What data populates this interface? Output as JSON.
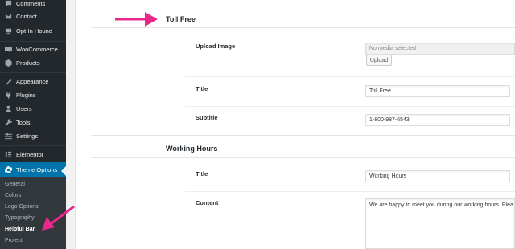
{
  "sidebar": {
    "items": [
      {
        "label": "Comments",
        "icon": "comments-icon"
      },
      {
        "label": "Contact",
        "icon": "mail-icon"
      },
      {
        "label": "Opt-In Hound",
        "icon": "optin-icon"
      },
      {
        "label": "WooCommerce",
        "icon": "woocommerce-icon"
      },
      {
        "label": "Products",
        "icon": "products-icon"
      },
      {
        "label": "Appearance",
        "icon": "appearance-icon"
      },
      {
        "label": "Plugins",
        "icon": "plugins-icon"
      },
      {
        "label": "Users",
        "icon": "users-icon"
      },
      {
        "label": "Tools",
        "icon": "tools-icon"
      },
      {
        "label": "Settings",
        "icon": "settings-icon"
      },
      {
        "label": "Elementor",
        "icon": "elementor-icon"
      },
      {
        "label": "Theme Options",
        "icon": "gear-icon"
      }
    ],
    "submenu": [
      "General",
      "Colors",
      "Logo Options",
      "Typography",
      "Helpful Bar",
      "Project"
    ],
    "current_submenu": "Helpful Bar"
  },
  "sections": {
    "toll_free": {
      "title": "Toll Free",
      "upload_label": "Upload Image",
      "media_placeholder": "No media selected",
      "upload_button": "Upload",
      "title_label": "Title",
      "title_value": "Toll Free",
      "subtitle_label": "Subtitle",
      "subtitle_value": "1-800-987-6543"
    },
    "working_hours": {
      "title": "Working Hours",
      "title_label": "Title",
      "title_value": "Working Hours",
      "content_label": "Content",
      "content_value": "We are happy to meet you during our working hours. Plea"
    }
  },
  "colors": {
    "sidebar_bg": "#23282d",
    "active_bg": "#0073aa",
    "annotation_arrow": "#e8298a"
  }
}
